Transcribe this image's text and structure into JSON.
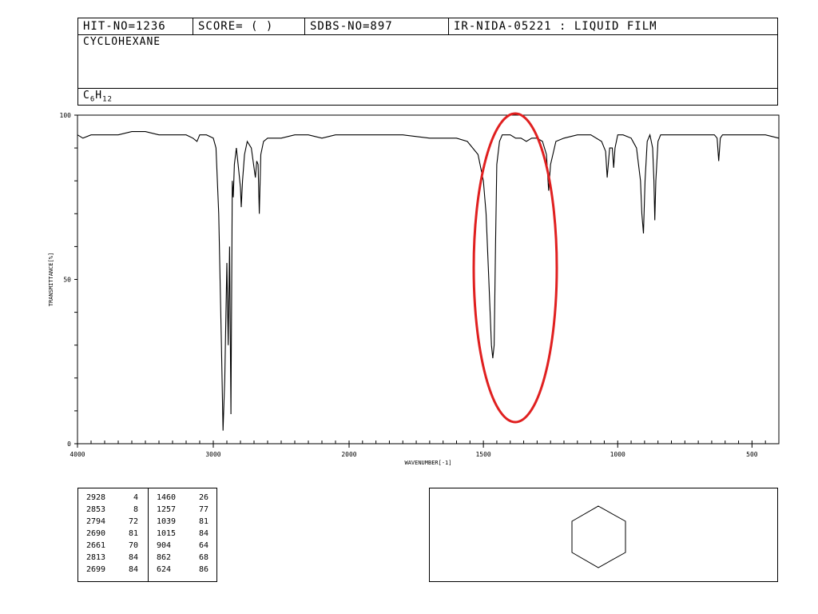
{
  "header": {
    "hit_no": "HIT-NO=1236",
    "score": "SCORE=  (   )",
    "sdbs_no": "SDBS-NO=897",
    "method": "IR-NIDA-05221 : LIQUID FILM",
    "compound": "CYCLOHEXANE",
    "formula_c": "C",
    "formula_c_sub": "6",
    "formula_h": "H",
    "formula_h_sub": "12"
  },
  "chart_data": {
    "type": "line",
    "xlabel": "WAVENUMBER[-1]",
    "ylabel": "TRANSMITTANCE[%]",
    "xlim": [
      4000,
      400
    ],
    "ylim": [
      0,
      100
    ],
    "x_ticks": [
      "4000",
      "3000",
      "2000",
      "1500",
      "1000",
      "500"
    ],
    "y_ticks": [
      "0",
      "50",
      "100"
    ],
    "series": [
      {
        "x": [
          4000,
          3960,
          3900,
          3800,
          3700,
          3600,
          3500,
          3400,
          3300,
          3200,
          3150,
          3120,
          3100,
          3050,
          3000,
          2980,
          2960,
          2940,
          2928,
          2915,
          2900,
          2890,
          2880,
          2870,
          2860,
          2853,
          2845,
          2830,
          2815,
          2800,
          2794,
          2785,
          2770,
          2750,
          2720,
          2700,
          2690,
          2680,
          2670,
          2661,
          2650,
          2630,
          2600,
          2500,
          2400,
          2300,
          2200,
          2100,
          2000,
          1900,
          1800,
          1700,
          1600,
          1560,
          1520,
          1500,
          1490,
          1480,
          1470,
          1465,
          1460,
          1455,
          1450,
          1440,
          1430,
          1420,
          1400,
          1380,
          1360,
          1340,
          1320,
          1300,
          1280,
          1265,
          1257,
          1250,
          1230,
          1200,
          1150,
          1100,
          1060,
          1045,
          1039,
          1030,
          1020,
          1015,
          1010,
          1000,
          980,
          950,
          930,
          915,
          910,
          904,
          898,
          890,
          880,
          870,
          865,
          862,
          858,
          850,
          840,
          800,
          750,
          700,
          660,
          640,
          630,
          624,
          618,
          610,
          580,
          540,
          500,
          450,
          400
        ],
        "y": [
          94,
          93,
          94,
          94,
          94,
          95,
          95,
          94,
          94,
          94,
          93,
          92,
          94,
          94,
          93,
          90,
          70,
          30,
          4,
          20,
          55,
          30,
          60,
          9,
          80,
          75,
          85,
          90,
          84,
          78,
          72,
          80,
          88,
          92,
          90,
          84,
          81,
          86,
          85,
          70,
          88,
          92,
          93,
          93,
          94,
          94,
          93,
          94,
          94,
          94,
          94,
          93,
          93,
          92,
          88,
          80,
          70,
          50,
          30,
          26,
          30,
          60,
          85,
          92,
          94,
          94,
          94,
          93,
          93,
          92,
          93,
          93,
          92,
          88,
          77,
          85,
          92,
          93,
          94,
          94,
          92,
          89,
          81,
          90,
          90,
          84,
          90,
          94,
          94,
          93,
          90,
          80,
          70,
          64,
          80,
          92,
          94,
          90,
          80,
          68,
          80,
          92,
          94,
          94,
          94,
          94,
          94,
          94,
          93,
          86,
          93,
          94,
          94,
          94,
          94,
          94,
          93
        ]
      }
    ]
  },
  "peak_table": {
    "left": [
      [
        "2928",
        "4"
      ],
      [
        "2853",
        "8"
      ],
      [
        "2794",
        "72"
      ],
      [
        "2690",
        "81"
      ],
      [
        "2661",
        "70"
      ],
      [
        "2813",
        "84"
      ],
      [
        "2699",
        "84"
      ]
    ],
    "right": [
      [
        "1460",
        "26"
      ],
      [
        "1257",
        "77"
      ],
      [
        "1039",
        "81"
      ],
      [
        "1015",
        "84"
      ],
      [
        "904",
        "64"
      ],
      [
        "862",
        "68"
      ],
      [
        "624",
        "86"
      ]
    ]
  },
  "annotation": {
    "color": "#e02020"
  },
  "structure": {
    "name": "cyclohexane-ring"
  }
}
